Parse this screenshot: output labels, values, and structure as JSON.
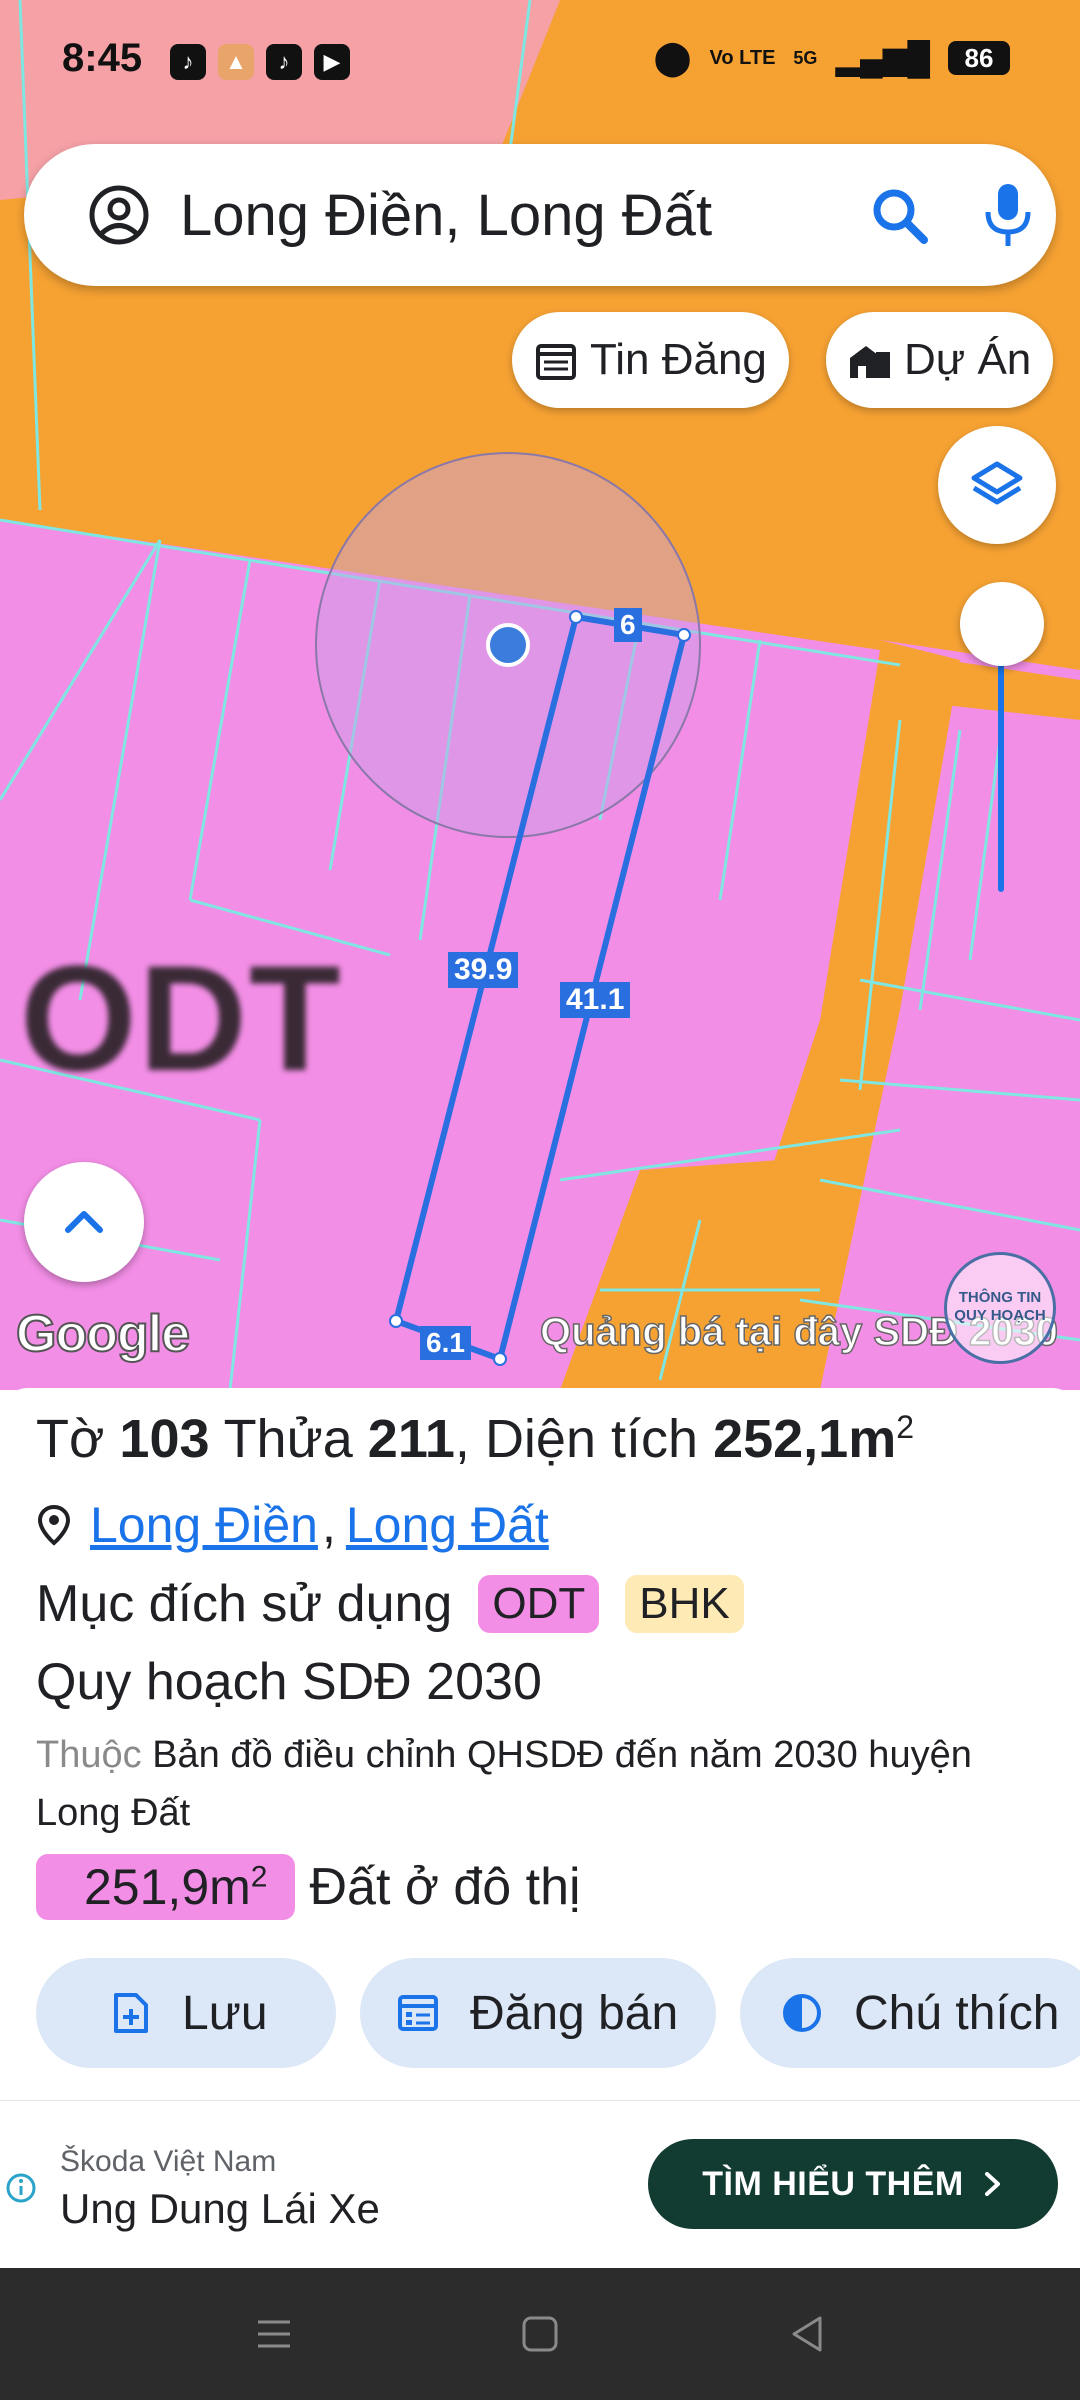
{
  "status_bar": {
    "time": "8:45",
    "apps": [
      "tiktok-icon",
      "photos-icon",
      "tiktok-icon",
      "youtube-icon"
    ],
    "network_label": "Vo LTE",
    "network_gen": "5G",
    "battery": "86"
  },
  "search": {
    "query": "Long Điền, Long Đất"
  },
  "chips": {
    "listings": "Tin Đăng",
    "projects": "Dự Án"
  },
  "map": {
    "zone_code": "ODT",
    "dims": {
      "top": "6",
      "left": "39.9",
      "right": "41.1",
      "bottom": "6.1"
    },
    "google_label": "Google",
    "overlay_text": "Quảng bá tại đây",
    "overlay_text2": "SDĐ 2030",
    "badge_text_1": "THÔNG TIN",
    "badge_text_2": "QUY HOẠCH"
  },
  "parcel": {
    "sheet_label": "Tờ",
    "sheet_no": "103",
    "lot_label": "Thửa",
    "lot_no": "211",
    "area_label": "Diện tích",
    "area_value": "252,1m",
    "area_unit_exp": "2",
    "district": "Long Điền",
    "sep": ",",
    "province": "Long Đất",
    "purpose_label": "Mục đích sử dụng",
    "purpose_tags": [
      "ODT",
      "BHK"
    ],
    "plan_title": "Quy hoạch SDĐ 2030",
    "belongs_prefix": "Thuộc",
    "belongs_text": "Bản đồ điều chỉnh QHSDĐ đến năm 2030 huyện Long Đất",
    "land_area": "251,9m",
    "land_area_exp": "2",
    "land_type": "Đất ở đô thị"
  },
  "actions": {
    "save": "Lưu",
    "post": "Đăng bán",
    "legend": "Chú thích"
  },
  "ad": {
    "brand": "Škoda Việt Nam",
    "title": "Ung Dung Lái Xe",
    "cta": "TÌM HIỂU THÊM"
  },
  "colors": {
    "zone_odt": "#f38ee6",
    "zone_orange": "#f6a233",
    "parcel_line": "#2a6fe0",
    "accent": "#1a73e8",
    "chip_bg": "#dce7f7",
    "cta_bg": "#123b32"
  }
}
